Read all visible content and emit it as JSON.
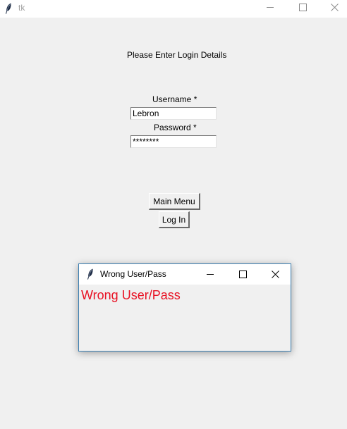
{
  "window": {
    "title": "tk",
    "icon": "feather-icon"
  },
  "form": {
    "heading": "Please Enter Login Details",
    "username_label": "Username *",
    "username_value": "Lebron",
    "password_label": "Password *",
    "password_value": "********"
  },
  "buttons": {
    "main_menu": "Main Menu",
    "log_in": "Log In"
  },
  "popup": {
    "title": "Wrong User/Pass",
    "icon": "feather-icon",
    "message": "Wrong User/Pass",
    "message_color": "#e81123"
  },
  "colors": {
    "background": "#f0f0f0",
    "titlebar": "#ffffff",
    "popup_border": "#3c7fb1",
    "error_text": "#e81123"
  }
}
